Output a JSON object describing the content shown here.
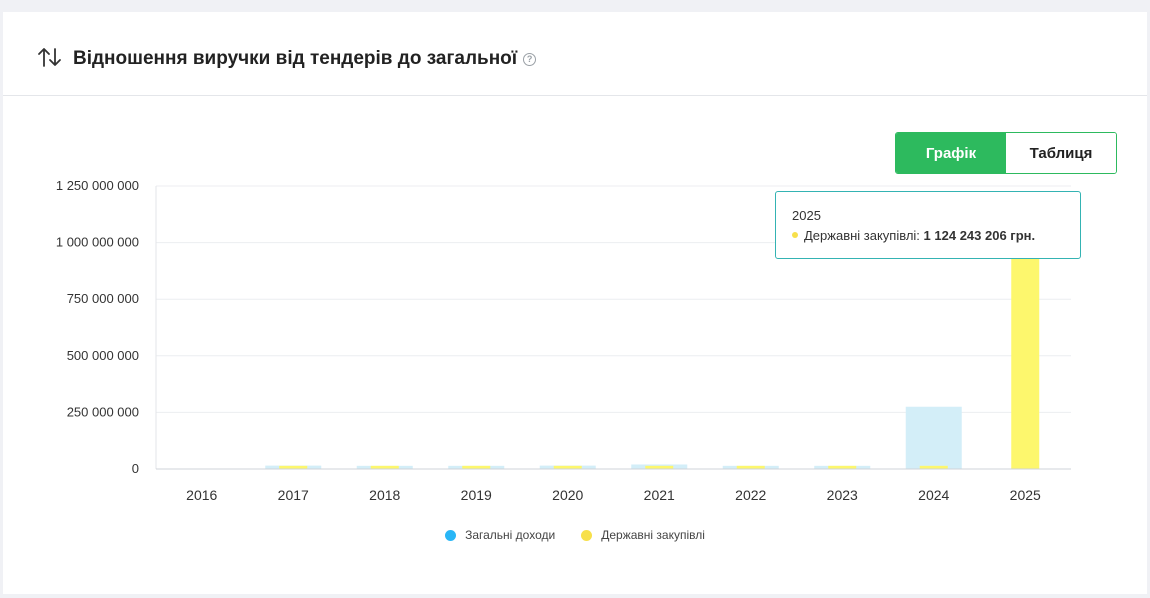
{
  "header": {
    "title": "Відношення виручки від тендерів до загальної",
    "help_glyph": "?"
  },
  "toggle": {
    "chart_label": "Графік",
    "table_label": "Таблиця"
  },
  "tooltip": {
    "year": "2025",
    "series_label": "Державні закупівлі:",
    "value_text": "1 124 243 206 грн."
  },
  "colors": {
    "accent_green": "#2dba5e",
    "total_series": "#29b6f6",
    "total_bar": "#d3eef8",
    "gov_series": "#f7e04b",
    "gov_bar": "#fdf76d",
    "tooltip_border": "#34b3b3"
  },
  "chart_data": {
    "type": "bar",
    "categories": [
      "2016",
      "2017",
      "2018",
      "2019",
      "2020",
      "2021",
      "2022",
      "2023",
      "2024",
      "2025"
    ],
    "series": [
      {
        "name": "Загальні доходи",
        "values": [
          0,
          15000000,
          14000000,
          14000000,
          15000000,
          20000000,
          14000000,
          14000000,
          275000000,
          0
        ]
      },
      {
        "name": "Державні закупівлі",
        "values": [
          0,
          14000000,
          14000000,
          14000000,
          14000000,
          14000000,
          14000000,
          14000000,
          14000000,
          1124243206
        ]
      }
    ],
    "yticks": [
      0,
      250000000,
      500000000,
      750000000,
      1000000000,
      1250000000
    ],
    "ytick_labels": [
      "0",
      "250 000 000",
      "500 000 000",
      "750 000 000",
      "1 000 000 000",
      "1 250 000 000"
    ],
    "ylim": [
      0,
      1250000000
    ],
    "grid": true,
    "legend": "bottom-center"
  }
}
